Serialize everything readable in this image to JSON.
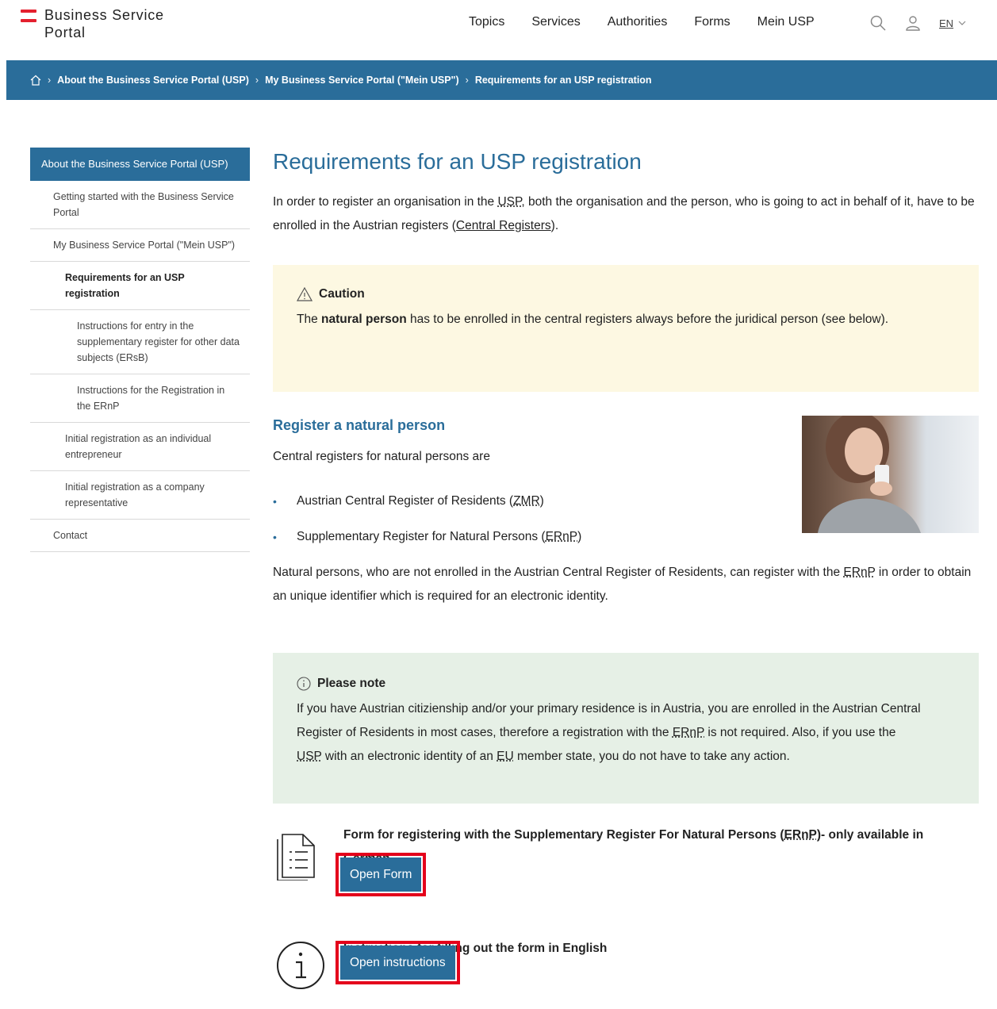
{
  "header": {
    "logo_line1": "Business Service",
    "logo_line2": "Portal",
    "nav": [
      "Topics",
      "Services",
      "Authorities",
      "Forms",
      "Mein USP"
    ],
    "lang": "EN"
  },
  "breadcrumb": {
    "items": [
      "About the Business Service Portal (USP)",
      "My Business Service Portal (\"Mein USP\")",
      "Requirements for an USP registration"
    ]
  },
  "sidebar": {
    "head": "About the Business Service Portal (USP)",
    "items": [
      "Getting started with the Business Service Portal",
      "My Business Service Portal (\"Mein USP\")",
      "Requirements for an USP registration",
      "Instructions for entry in the supplementary register for other data subjects (ERsB)",
      "Instructions for the Registration in the ERnP",
      "Initial registration as an individual entrepreneur",
      "Initial registration as a company representative",
      "Contact"
    ]
  },
  "main": {
    "title": "Requirements for an USP registration",
    "intro_a": "In order to register an organisation in the ",
    "intro_usp": "USP",
    "intro_b": ", both the organisation and the person, who is going to act in behalf of it, have to be enrolled in the Austrian registers (",
    "intro_link": "Central Registers",
    "intro_c": ").",
    "caution": {
      "title": "Caution",
      "text_a": "The ",
      "text_bold": "natural person",
      "text_b": " has to be enrolled in the central registers always before the juridical person (see below)."
    },
    "natural": {
      "heading": "Register a natural person",
      "lead": "Central registers for natural persons are",
      "bullet1_a": "Austrian Central Register of Residents (",
      "bullet1_abbr": "ZMR",
      "bullet1_b": ")",
      "bullet2_a": "Supplementary Register for Natural Persons (",
      "bullet2_abbr": "ERnP",
      "bullet2_b": ")",
      "para_a": "Natural persons, who are not enrolled in the Austrian Central Register of Residents, can register with the ",
      "para_abbr": "ERnP",
      "para_b": " in order to obtain an unique identifier which is required for an electronic identity."
    },
    "note": {
      "title": "Please note",
      "text_a": "If you have Austrian citizienship and/or your primary residence is in Austria, you are enrolled in the Austrian Central Register of Residents in most cases, therefore a registration with the ",
      "text_ernp": "ERnP",
      "text_b": " is not required. Also, if you use the ",
      "text_usp": "USP",
      "text_c": " with an electronic identity of an ",
      "text_eu": "EU",
      "text_d": " member state, you do not have to take any action."
    },
    "form_download": {
      "title_a": "Form for registering with the Supplementary Register For Natural Persons (",
      "title_abbr": "ERnP",
      "title_b": ")- only available in German",
      "button": "Open Form"
    },
    "instructions_download": {
      "title": "Instructions for filling out the form in English",
      "button": "Open instructions"
    }
  },
  "colors": {
    "brand_blue": "#2a6d9a",
    "caution_bg": "#fdf8e2",
    "note_bg": "#e6f0e6",
    "highlight_red": "#e4001b"
  }
}
